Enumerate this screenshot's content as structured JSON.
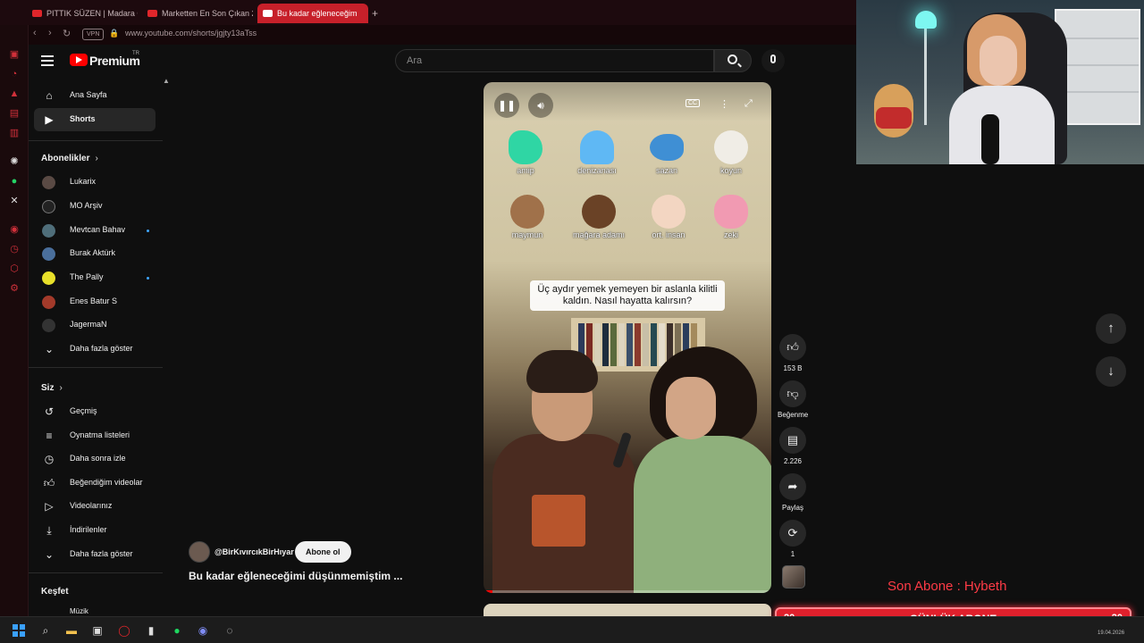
{
  "browser": {
    "tabs": [
      {
        "label": "PITTIK SÜZEN | Madara O"
      },
      {
        "label": "Marketten En Son Çıkan 2"
      },
      {
        "label": "Bu kadar eğleneceğim"
      }
    ],
    "vpn_label": "VPN",
    "url": "www.youtube.com/shorts/jgjty13aTss"
  },
  "header": {
    "brand": "Premium",
    "brand_region": "TR",
    "search_placeholder": "Ara",
    "icons": {
      "menu": "hamburger-icon",
      "search": "search-icon",
      "mic": "mic-icon"
    }
  },
  "sidebar": {
    "main": [
      {
        "label": "Ana Sayfa",
        "icon": "home-icon"
      },
      {
        "label": "Shorts",
        "icon": "shorts-icon"
      }
    ],
    "subscriptions_heading": "Abonelikler",
    "subscriptions": [
      {
        "label": "Lukarix",
        "color": "#5a4a44",
        "live": false
      },
      {
        "label": "MO Arşiv",
        "color": "#222222",
        "live": false
      },
      {
        "label": "Mevtcan Bahav",
        "color": "#4f6e7a",
        "live": true
      },
      {
        "label": "Burak Aktürk",
        "color": "#4a6f9c",
        "live": false
      },
      {
        "label": "The Pally",
        "color": "#e8e02a",
        "live": true
      },
      {
        "label": "Enes Batur S",
        "color": "#a33a2a",
        "live": false
      },
      {
        "label": "JagermaN",
        "color": "#333333",
        "live": false
      }
    ],
    "show_more_1": "Daha fazla göster",
    "you_heading": "Siz",
    "you": [
      {
        "label": "Geçmiş",
        "icon": "history-icon"
      },
      {
        "label": "Oynatma listeleri",
        "icon": "playlist-icon"
      },
      {
        "label": "Daha sonra izle",
        "icon": "clock-icon"
      },
      {
        "label": "Beğendiğim videolar",
        "icon": "like-icon"
      },
      {
        "label": "Videolarınız",
        "icon": "video-icon"
      },
      {
        "label": "İndirilenler",
        "icon": "download-icon"
      }
    ],
    "show_more_2": "Daha fazla göster",
    "explore_heading": "Keşfet",
    "explore_first": "Müzik"
  },
  "video": {
    "emoji_items": [
      {
        "label": "amip",
        "color": "#2fd6a4"
      },
      {
        "label": "denizanası",
        "color": "#5fb8f4"
      },
      {
        "label": "sazan",
        "color": "#3f8fd4"
      },
      {
        "label": "koyun",
        "color": "#f0ede6"
      },
      {
        "label": "maymun",
        "color": "#a0714a"
      },
      {
        "label": "mağara adamı",
        "color": "#6a4226"
      },
      {
        "label": "ort. insan",
        "color": "#f3d6c2"
      },
      {
        "label": "zeki",
        "color": "#f19ab2"
      }
    ],
    "caption": "Üç aydır yemek yemeyen bir aslanla kilitli kaldın. Nasıl hayatta kalırsın?",
    "progress": 0.03,
    "channel": "@BirKıvırcıkBirHıyar",
    "subscribe_label": "Abone ol",
    "title": "Bu kadar eğleneceğimi düşünmemiştim ..."
  },
  "actions": [
    {
      "label": "153 B",
      "icon": "thumbs-up-icon"
    },
    {
      "label": "Beğenme",
      "icon": "thumbs-down-icon"
    },
    {
      "label": "2.226",
      "icon": "comment-icon"
    },
    {
      "label": "Paylaş",
      "icon": "share-icon"
    },
    {
      "label": "1",
      "icon": "remix-icon"
    }
  ],
  "overlay": {
    "last_sub": "Son Abone : Hybeth",
    "daily_title": "GÜNLÜK ABONE",
    "daily_left": "20",
    "daily_right": "20"
  },
  "taskbar": {
    "date": "19.04.2026"
  }
}
